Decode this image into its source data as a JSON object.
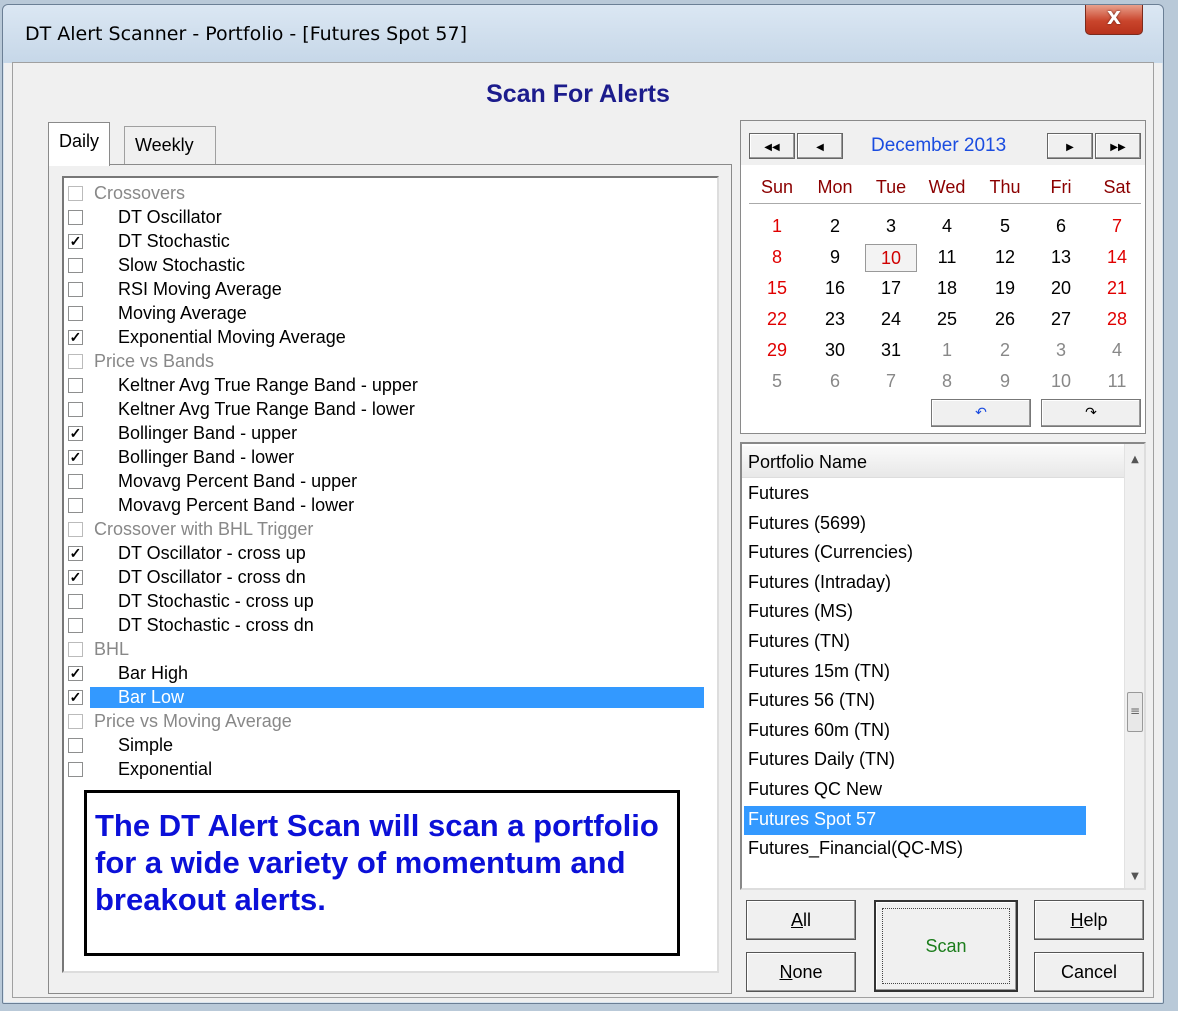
{
  "window": {
    "title": "DT Alert Scanner - Portfolio - [Futures Spot 57]",
    "close_label": "X"
  },
  "heading": "Scan For Alerts",
  "tabs": [
    {
      "label": "Daily"
    },
    {
      "label": "Weekly"
    }
  ],
  "alerts": [
    {
      "label": "Crossovers",
      "type": "group",
      "checked": false
    },
    {
      "label": "DT Oscillator",
      "type": "item",
      "checked": false
    },
    {
      "label": "DT Stochastic",
      "type": "item",
      "checked": true
    },
    {
      "label": "Slow Stochastic",
      "type": "item",
      "checked": false
    },
    {
      "label": "RSI Moving Average",
      "type": "item",
      "checked": false
    },
    {
      "label": "Moving Average",
      "type": "item",
      "checked": false
    },
    {
      "label": "Exponential Moving Average",
      "type": "item",
      "checked": true
    },
    {
      "label": "Price vs Bands",
      "type": "group",
      "checked": false
    },
    {
      "label": "Keltner Avg True Range Band - upper",
      "type": "item",
      "checked": false
    },
    {
      "label": "Keltner Avg True Range Band - lower",
      "type": "item",
      "checked": false
    },
    {
      "label": "Bollinger Band - upper",
      "type": "item",
      "checked": true
    },
    {
      "label": "Bollinger Band - lower",
      "type": "item",
      "checked": true
    },
    {
      "label": "Movavg Percent Band - upper",
      "type": "item",
      "checked": false
    },
    {
      "label": "Movavg Percent Band - lower",
      "type": "item",
      "checked": false
    },
    {
      "label": "Crossover with BHL Trigger",
      "type": "group",
      "checked": false
    },
    {
      "label": "DT Oscillator - cross up",
      "type": "item",
      "checked": true
    },
    {
      "label": "DT Oscillator - cross dn",
      "type": "item",
      "checked": true
    },
    {
      "label": "DT Stochastic - cross up",
      "type": "item",
      "checked": false
    },
    {
      "label": "DT Stochastic - cross dn",
      "type": "item",
      "checked": false
    },
    {
      "label": "BHL",
      "type": "group",
      "checked": false
    },
    {
      "label": "Bar High",
      "type": "item",
      "checked": true
    },
    {
      "label": "Bar Low",
      "type": "item",
      "checked": true,
      "selected": true
    },
    {
      "label": "Price vs Moving Average",
      "type": "group",
      "checked": false
    },
    {
      "label": "Simple",
      "type": "item",
      "checked": false
    },
    {
      "label": "Exponential",
      "type": "item",
      "checked": false
    }
  ],
  "info_text": "The DT Alert Scan will scan a portfolio for a wide variety of momentum and breakout alerts.",
  "calendar": {
    "month_label": "December 2013",
    "nav": {
      "first": "◀◀",
      "prev": "◀",
      "next": "▶",
      "last": "▶▶"
    },
    "weekdays": [
      "Sun",
      "Mon",
      "Tue",
      "Wed",
      "Thu",
      "Fri",
      "Sat"
    ],
    "weeks": [
      [
        "1",
        "2",
        "3",
        "4",
        "5",
        "6",
        "7"
      ],
      [
        "8",
        "9",
        "10",
        "11",
        "12",
        "13",
        "14"
      ],
      [
        "15",
        "16",
        "17",
        "18",
        "19",
        "20",
        "21"
      ],
      [
        "22",
        "23",
        "24",
        "25",
        "26",
        "27",
        "28"
      ],
      [
        "29",
        "30",
        "31",
        "1",
        "2",
        "3",
        "4"
      ],
      [
        "5",
        "6",
        "7",
        "8",
        "9",
        "10",
        "11"
      ]
    ],
    "today": "10",
    "undo_label": "↶",
    "redo_label": "↷"
  },
  "portfolio": {
    "header": "Portfolio Name",
    "items": [
      "Futures",
      "Futures (5699)",
      "Futures (Currencies)",
      "Futures (Intraday)",
      "Futures (MS)",
      "Futures (TN)",
      "Futures 15m (TN)",
      "Futures 56 (TN)",
      "Futures 60m (TN)",
      "Futures Daily (TN)",
      "Futures QC New",
      "Futures Spot 57",
      "Futures_Financial(QC-MS)"
    ],
    "selected": "Futures Spot 57"
  },
  "buttons": {
    "all_hotkey": "A",
    "all_rest": "ll",
    "none_hotkey": "N",
    "none_rest": "one",
    "scan": "Scan",
    "help_hotkey": "H",
    "help_rest": "elp",
    "cancel": "Cancel"
  },
  "colors": {
    "heading": "#1c1c8c",
    "info_text": "#0b10d8",
    "selection": "#3399ff",
    "month": "#1a4ce0",
    "weekend": "#e00000",
    "scan_text": "#1c7d1c"
  }
}
